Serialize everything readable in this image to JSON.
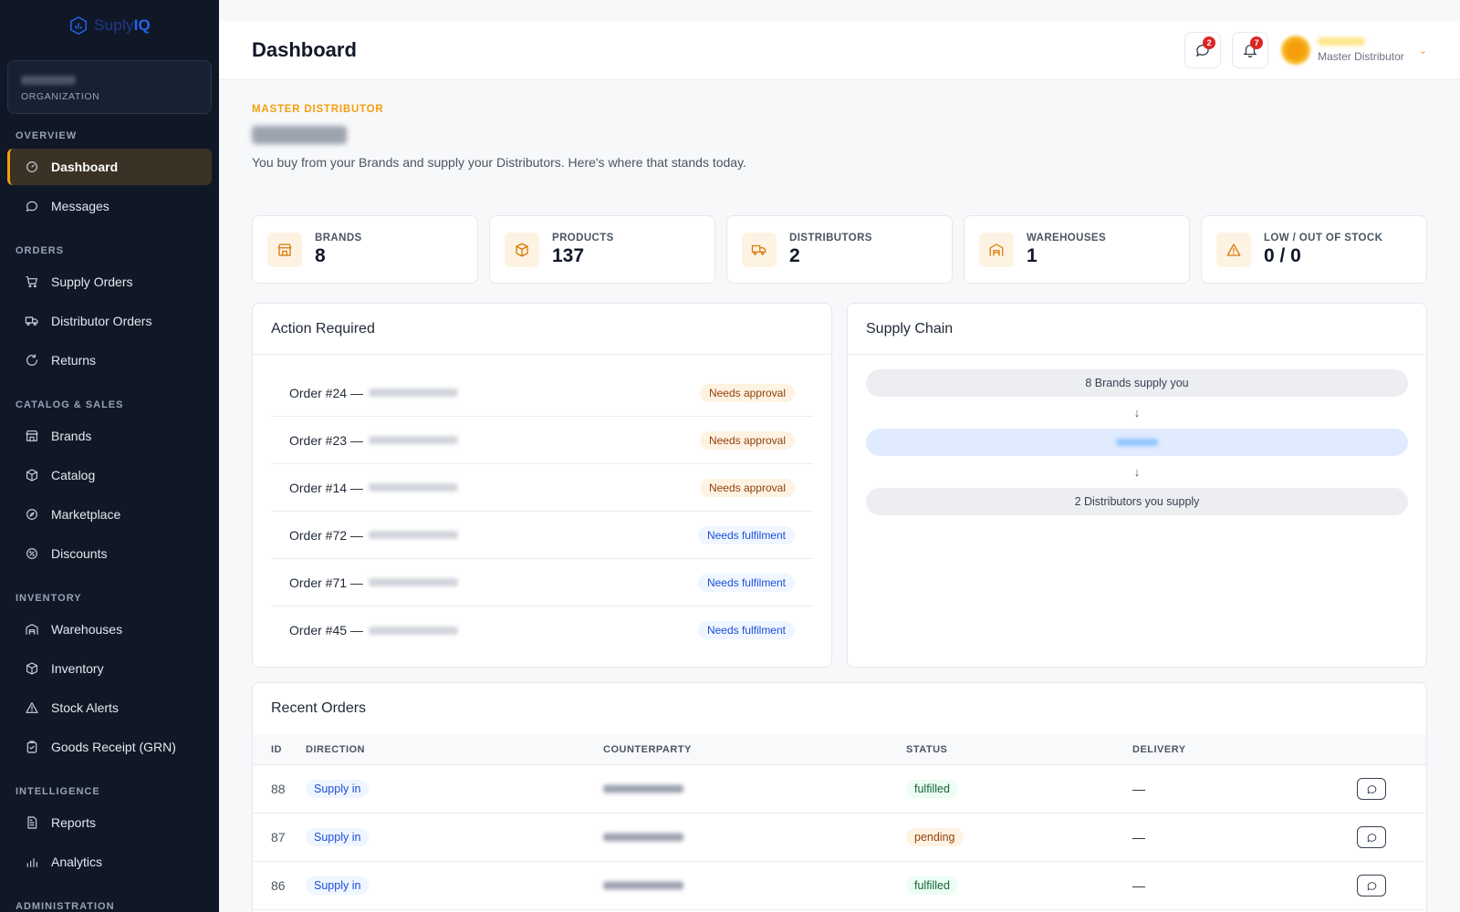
{
  "app": {
    "logo_text_a": "Suply",
    "logo_text_b": "IQ"
  },
  "sidebar": {
    "org_label": "ORGANIZATION",
    "sections": [
      {
        "title": "OVERVIEW",
        "items": [
          {
            "label": "Dashboard",
            "icon": "gauge-icon",
            "active": true
          },
          {
            "label": "Messages",
            "icon": "chat-bubble-icon"
          }
        ]
      },
      {
        "title": "ORDERS",
        "items": [
          {
            "label": "Supply Orders",
            "icon": "cart-icon"
          },
          {
            "label": "Distributor Orders",
            "icon": "truck-icon"
          },
          {
            "label": "Returns",
            "icon": "return-icon"
          }
        ]
      },
      {
        "title": "CATALOG & SALES",
        "items": [
          {
            "label": "Brands",
            "icon": "store-icon"
          },
          {
            "label": "Catalog",
            "icon": "box-icon"
          },
          {
            "label": "Marketplace",
            "icon": "compass-icon"
          },
          {
            "label": "Discounts",
            "icon": "discount-icon"
          }
        ]
      },
      {
        "title": "INVENTORY",
        "items": [
          {
            "label": "Warehouses",
            "icon": "warehouse-icon"
          },
          {
            "label": "Inventory",
            "icon": "box-icon"
          },
          {
            "label": "Stock Alerts",
            "icon": "warning-icon"
          },
          {
            "label": "Goods Receipt (GRN)",
            "icon": "clipboard-icon"
          }
        ]
      },
      {
        "title": "INTELLIGENCE",
        "items": [
          {
            "label": "Reports",
            "icon": "report-icon"
          },
          {
            "label": "Analytics",
            "icon": "bar-chart-icon"
          }
        ]
      },
      {
        "title": "ADMINISTRATION",
        "items": []
      }
    ]
  },
  "header": {
    "title": "Dashboard",
    "messages_badge": "2",
    "notifications_badge": "7",
    "user_role": "Master Distributor"
  },
  "main": {
    "eyebrow": "MASTER DISTRIBUTOR",
    "lead": "You buy from your Brands and supply your Distributors. Here's where that stands today."
  },
  "stats": [
    {
      "label": "BRANDS",
      "value": "8",
      "icon": "store-icon"
    },
    {
      "label": "PRODUCTS",
      "value": "137",
      "icon": "box-icon"
    },
    {
      "label": "DISTRIBUTORS",
      "value": "2",
      "icon": "truck-icon"
    },
    {
      "label": "WAREHOUSES",
      "value": "1",
      "icon": "warehouse-icon"
    },
    {
      "label": "LOW / OUT OF STOCK",
      "value": "0 / 0",
      "icon": "warning-icon"
    }
  ],
  "action_required": {
    "title": "Action Required",
    "rows": [
      {
        "order": "Order #24 —",
        "status": "Needs approval",
        "kind": "approval"
      },
      {
        "order": "Order #23 —",
        "status": "Needs approval",
        "kind": "approval"
      },
      {
        "order": "Order #14 —",
        "status": "Needs approval",
        "kind": "approval"
      },
      {
        "order": "Order #72 —",
        "status": "Needs fulfilment",
        "kind": "fulfil"
      },
      {
        "order": "Order #71 —",
        "status": "Needs fulfilment",
        "kind": "fulfil"
      },
      {
        "order": "Order #45 —",
        "status": "Needs fulfilment",
        "kind": "fulfil"
      }
    ]
  },
  "supply_chain": {
    "title": "Supply Chain",
    "top": "8 Brands supply you",
    "arrow": "↓",
    "bottom": "2 Distributors you supply"
  },
  "recent_orders": {
    "title": "Recent Orders",
    "columns": [
      "ID",
      "DIRECTION",
      "COUNTERPARTY",
      "STATUS",
      "DELIVERY"
    ],
    "rows": [
      {
        "id": "88",
        "direction": "Supply in",
        "status": "fulfilled",
        "delivery": "—"
      },
      {
        "id": "87",
        "direction": "Supply in",
        "status": "pending",
        "delivery": "—"
      },
      {
        "id": "86",
        "direction": "Supply in",
        "status": "fulfilled",
        "delivery": "—"
      }
    ]
  },
  "colors": {
    "accent": "#f59e0b",
    "sidebar_bg": "#101828",
    "link_blue": "#1d4ed8"
  }
}
